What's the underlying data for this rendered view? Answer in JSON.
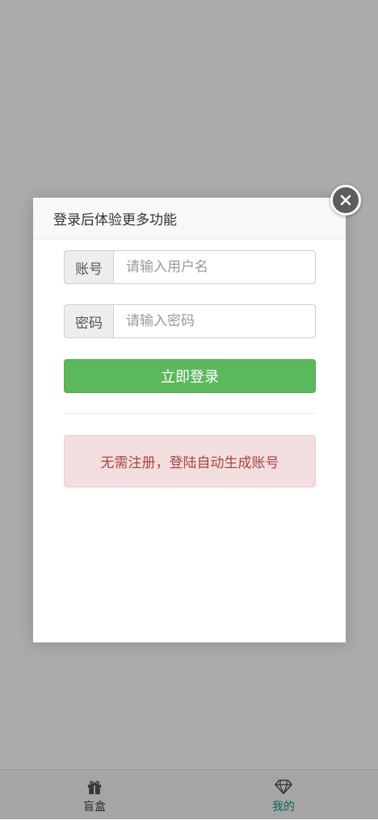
{
  "modal": {
    "title": "登录后体验更多功能",
    "username_label": "账号",
    "username_placeholder": "请输入用户名",
    "password_label": "密码",
    "password_placeholder": "请输入密码",
    "login_button": "立即登录",
    "notice": "无需注册，登陆自动生成账号"
  },
  "bottom_nav": {
    "items": [
      {
        "label": "盲盒",
        "icon": "gift-icon",
        "active": false
      },
      {
        "label": "我的",
        "icon": "diamond-icon",
        "active": true
      }
    ]
  },
  "colors": {
    "primary_button": "#5cb85c",
    "alert_bg": "#f2dede",
    "alert_text": "#a94442",
    "active_nav": "#109a86"
  }
}
